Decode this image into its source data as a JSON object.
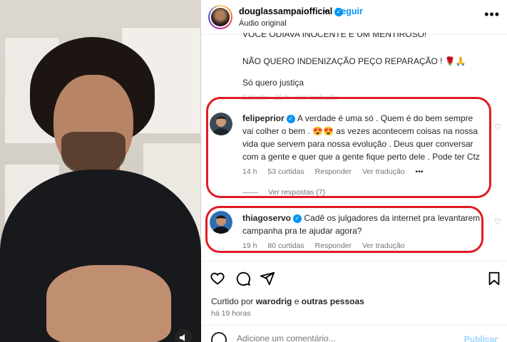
{
  "header": {
    "username": "douglassampaiofficial",
    "follow_label": "Seguir",
    "separator": "•",
    "audio_label": "Áudio original",
    "more_label": "•••"
  },
  "caption": {
    "line_cut": "VOCÊ ODIAVA INOCENTE E UM MENTIROSO!",
    "line_1": "NÃO QUERO INDENIZAÇÃO PEÇO REPARAÇÃO ! 🌹🙏",
    "line_2": "Só quero justiça",
    "meta_time": "Editado · 19 h",
    "meta_translate": "Ver tradução"
  },
  "comments": [
    {
      "username": "felipeprior",
      "text_1": "A verdade é uma só . Quem é do bem sempre",
      "text_2": "vai colher o bem . 😍😍 as vezes acontecem coisas na nossa",
      "text_3": "vida que servem para nossa evolução . Deus quer conversar",
      "text_4": "com a gente e quer que a gente fique perto dele . Pode ter Ctz",
      "time": "14 h",
      "likes": "53 curtidas",
      "reply": "Responder",
      "translate": "Ver tradução",
      "more": "•••",
      "replies": "Ver respostas (7)"
    },
    {
      "username": "thiagoservo",
      "text_1": "Cadê os julgadores da internet pra levantarem",
      "text_2": "campanha pra te ajudar agora?",
      "time": "19 h",
      "likes": "80 curtidas",
      "reply": "Responder",
      "translate": "Ver tradução"
    }
  ],
  "footer": {
    "liked_by_prefix": "Curtido por",
    "liked_by_user": "warodrig",
    "liked_by_connector": "e",
    "liked_by_others": "outras pessoas",
    "time_ago": "há 19 horas",
    "comment_placeholder": "Adicione um comentário...",
    "post_label": "Publicar"
  },
  "colors": {
    "accent": "#0095f6",
    "highlight": "#e11b22"
  }
}
